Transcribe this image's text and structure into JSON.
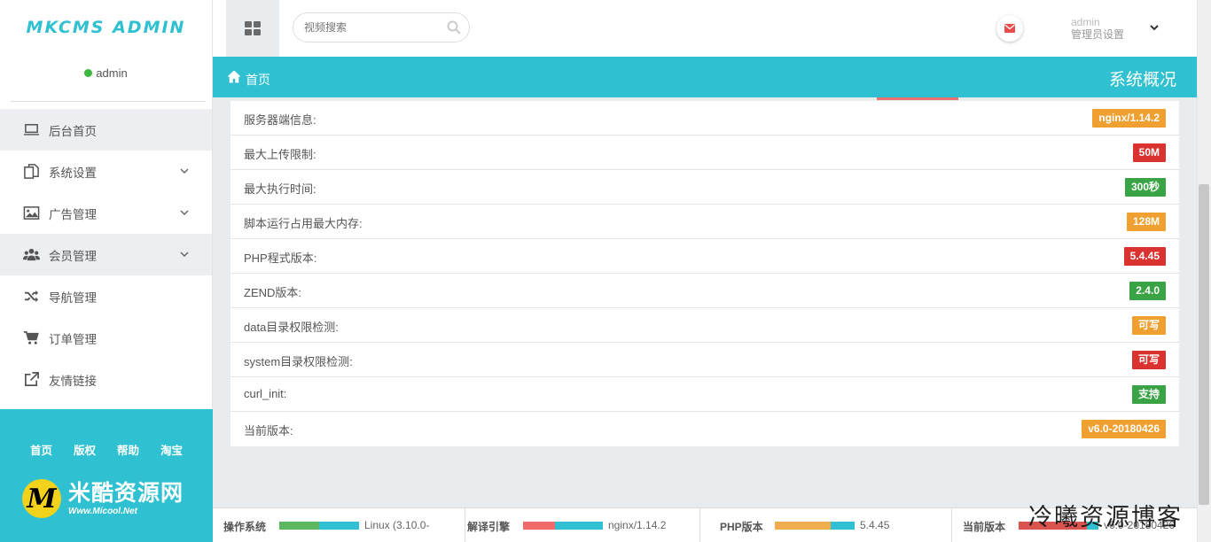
{
  "sidebar": {
    "logo": "MKCMS ADMIN",
    "user": "admin",
    "menu": [
      {
        "label": "后台首页",
        "icon": "laptop-icon",
        "chevron": false
      },
      {
        "label": "系统设置",
        "icon": "copy-icon",
        "chevron": true
      },
      {
        "label": "广告管理",
        "icon": "image-icon",
        "chevron": true
      },
      {
        "label": "会员管理",
        "icon": "users-icon",
        "chevron": true
      },
      {
        "label": "导航管理",
        "icon": "shuffle-icon",
        "chevron": false
      },
      {
        "label": "订单管理",
        "icon": "cart-icon",
        "chevron": false
      },
      {
        "label": "友情链接",
        "icon": "external-link-icon",
        "chevron": false
      }
    ],
    "footer_links": [
      "首页",
      "版权",
      "帮助",
      "淘宝"
    ],
    "brand": {
      "mark": "M",
      "title": "米酷资源网",
      "subtitle": "Www.Micool.Net"
    }
  },
  "topbar": {
    "search_placeholder": "视频搜索",
    "admin_name": "admin",
    "admin_sub": "管理员设置"
  },
  "breadcrumb": {
    "home": "首页",
    "title": "系统概况"
  },
  "info_rows": [
    {
      "label": "服务器端信息:",
      "value": "nginx/1.14.2",
      "color": "#f0a030"
    },
    {
      "label": "最大上传限制:",
      "value": "50M",
      "color": "#d9322f"
    },
    {
      "label": "最大执行时间:",
      "value": "300秒",
      "color": "#3aa346"
    },
    {
      "label": "脚本运行占用最大内存:",
      "value": "128M",
      "color": "#f0a030"
    },
    {
      "label": "PHP程式版本:",
      "value": "5.4.45",
      "color": "#d9322f"
    },
    {
      "label": "ZEND版本:",
      "value": "2.4.0",
      "color": "#3aa346"
    },
    {
      "label": "data目录权限检测:",
      "value": "可写",
      "color": "#f0a030"
    },
    {
      "label": "system目录权限检测:",
      "value": "可写",
      "color": "#d9322f"
    },
    {
      "label": "curl_init:",
      "value": "支持",
      "color": "#3aa346"
    },
    {
      "label": "当前版本:",
      "value": "v6.0-20180426",
      "color": "#f0a030"
    }
  ],
  "footer_status": [
    {
      "label": "操作系统",
      "value": "Linux (3.10.0-",
      "fill_color": "#5cb85c",
      "fill_fraction": 0.5
    },
    {
      "label": "解译引擎",
      "value": "nginx/1.14.2",
      "fill_color": "#f26b6b",
      "fill_fraction": 0.4
    },
    {
      "label": "PHP版本",
      "value": "5.4.45",
      "fill_color": "#f0ad4e",
      "fill_fraction": 0.7
    },
    {
      "label": "当前版本",
      "value": "v6.0-20180426",
      "fill_color": "#d9534f",
      "fill_fraction": 0.85
    }
  ],
  "watermark": "冷曦资源博客",
  "colors": {
    "accent": "#2fc1d1",
    "underline": "#ef6f6c",
    "online": "#3cb73c"
  }
}
